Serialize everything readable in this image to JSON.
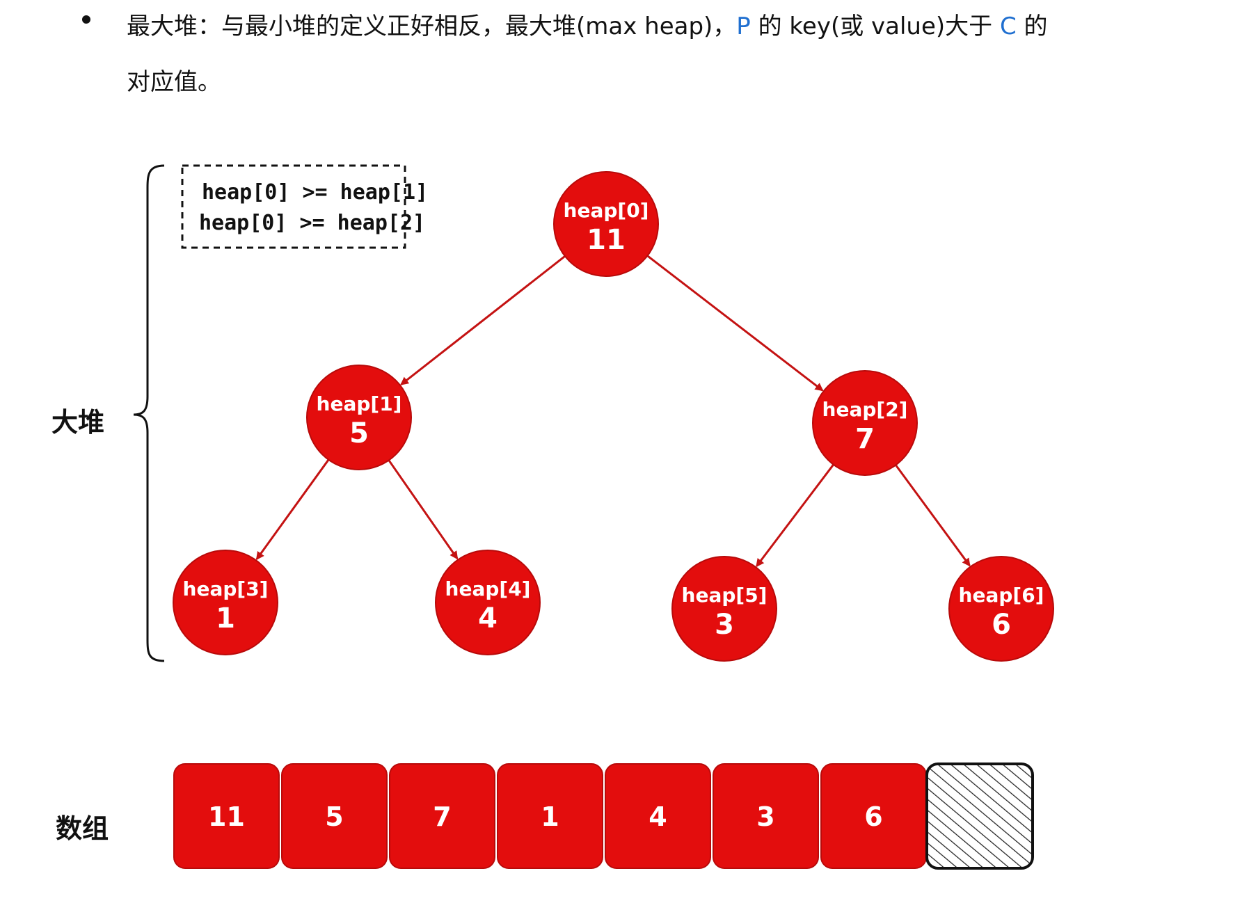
{
  "text": {
    "line1_a": "最大堆：与最小堆的定义正好相反，最大堆(max heap)，",
    "line1_p": "P",
    "line1_b": " 的 key(或 value)大于 ",
    "line1_c": "C",
    "line1_d": " 的",
    "line2": "对应值。"
  },
  "labels": {
    "heap_label": "大堆",
    "array_label": "数组"
  },
  "condition": {
    "line1": "heap[0] >= heap[1]",
    "line2": "heap[0] >= heap[2]"
  },
  "nodes": [
    {
      "name": "heap[0]",
      "value": "11"
    },
    {
      "name": "heap[1]",
      "value": "5"
    },
    {
      "name": "heap[2]",
      "value": "7"
    },
    {
      "name": "heap[3]",
      "value": "1"
    },
    {
      "name": "heap[4]",
      "value": "4"
    },
    {
      "name": "heap[5]",
      "value": "3"
    },
    {
      "name": "heap[6]",
      "value": "6"
    }
  ],
  "edges": [
    [
      0,
      1
    ],
    [
      0,
      2
    ],
    [
      1,
      3
    ],
    [
      1,
      4
    ],
    [
      2,
      5
    ],
    [
      2,
      6
    ]
  ],
  "array": [
    "11",
    "5",
    "7",
    "1",
    "4",
    "3",
    "6"
  ],
  "colors": {
    "node_fill": "#e30d0d",
    "edge": "#c41212",
    "cell_fill": "#e30d0d"
  }
}
